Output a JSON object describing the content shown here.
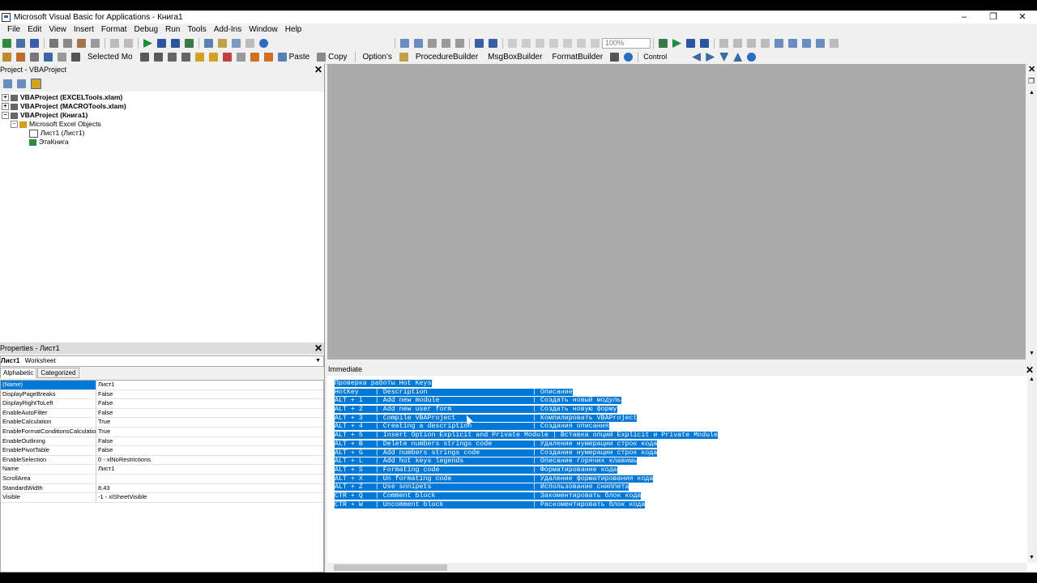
{
  "window": {
    "title": "Microsoft Visual Basic for Applications - Книга1",
    "minimize": "–",
    "restore": "❐",
    "close": "✕"
  },
  "menu": [
    "File",
    "Edit",
    "View",
    "Insert",
    "Format",
    "Debug",
    "Run",
    "Tools",
    "Add-Ins",
    "Window",
    "Help"
  ],
  "toolbar1": {
    "zoom": "100%"
  },
  "toolbar2": {
    "selected_mode": "Selected Mo",
    "paste": "Paste",
    "copy": "Copy",
    "options": "Option's",
    "procedure_builder": "ProcedureBuilder",
    "msgbox_builder": "MsgBoxBuilder",
    "format_builder": "FormatBuilder",
    "control": "Control"
  },
  "project": {
    "title": "Project - VBAProject",
    "tree": [
      {
        "label": "VBAProject (EXCELTools.xlam)",
        "bold": true
      },
      {
        "label": "VBAProject (MACROTools.xlam)",
        "bold": true
      },
      {
        "label": "VBAProject (Книга1)",
        "bold": true
      },
      {
        "label": "Microsoft Excel Objects",
        "bold": false
      },
      {
        "label": "Лист1 (Лист1)",
        "bold": false
      },
      {
        "label": "ЭтаКнига",
        "bold": false
      }
    ]
  },
  "properties": {
    "title": "Properties - Лист1",
    "object_name": "Лист1",
    "object_type": "Worksheet",
    "tabs": [
      "Alphabetic",
      "Categorized"
    ],
    "rows": [
      {
        "name": "(Name)",
        "value": "Лист1"
      },
      {
        "name": "DisplayPageBreaks",
        "value": "False"
      },
      {
        "name": "DisplayRightToLeft",
        "value": "False"
      },
      {
        "name": "EnableAutoFilter",
        "value": "False"
      },
      {
        "name": "EnableCalculation",
        "value": "True"
      },
      {
        "name": "EnableFormatConditionsCalculation",
        "value": "True"
      },
      {
        "name": "EnableOutlining",
        "value": "False"
      },
      {
        "name": "EnablePivotTable",
        "value": "False"
      },
      {
        "name": "EnableSelection",
        "value": "0 - xlNoRestrictions"
      },
      {
        "name": "Name",
        "value": "Лист1"
      },
      {
        "name": "ScrollArea",
        "value": ""
      },
      {
        "name": "StandardWidth",
        "value": "8,43"
      },
      {
        "name": "Visible",
        "value": "-1 - xlSheetVisible"
      }
    ]
  },
  "immediate": {
    "title": "Immediate",
    "lines": [
      "Проверка работы Hot Keys",
      "HotKey    | Description                          | Описание",
      "ALT + 1   | Add new module                       | Создать новый модуль",
      "ALT + 2   | Add new user form                    | Создать новую форму",
      "ALT + 3   | Compile VBAProject                   | Компилировать VBAProject",
      "ALT + 4   | Creating a description               | Создания описания",
      "ALT + 5   | Insert Option Explicit and Private Module | Вставка опций Explicit и Private Module",
      "ALT + B   | Delete numbers strings code          | Удаление нумерации строк кода",
      "ALT + G   | Add numbers strings code             | Создание нумерации строк кода",
      "ALT + L   | Add hot keys legends                 | Описание горячих клавишь",
      "ALT + S   | Formating code                       | Форматирование кода",
      "ALT + X   | Un formating code                    | Удаление форматирования кода",
      "ALT + Z   | Use snnipets                         | Использование сниппета",
      "CTR + Q   | Comment block                        | Закоментировать блок кода",
      "CTR + W   | Uncomment block                      | Раскоментировать блок кода"
    ]
  }
}
